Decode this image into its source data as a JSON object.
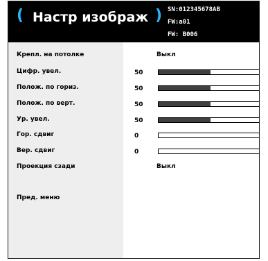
{
  "header": {
    "left_paren": "(",
    "title": "Настр изображ",
    "right_paren": ")",
    "serial": "SN:012345678AB",
    "fw1": "FW:a01",
    "fw2": "FW: B006"
  },
  "menu": {
    "items": [
      {
        "label": "Крепл. на потолке",
        "text_value": "Выкл"
      },
      {
        "label": "Цифр. увел.",
        "value": "50",
        "level": 0.5
      },
      {
        "label": "Полож. по гориз.",
        "value": "50",
        "level": 0.5
      },
      {
        "label": "Полож. по верт.",
        "value": "50",
        "level": 0.5
      },
      {
        "label": "Ур. увел.",
        "value": "50",
        "level": 0.5
      },
      {
        "label": "Гор. сдвиг",
        "value": "0",
        "level": 0
      },
      {
        "label": "Вер. сдвиг",
        "value": "0",
        "level": 0
      },
      {
        "label": "Проекция сзади",
        "text_value": "Выкл"
      }
    ],
    "previous_menu": "Пред. меню"
  },
  "colors": {
    "header_bg": "#000000",
    "accent": "#29b6f6",
    "label_panel": "#eeeeee",
    "bar_fill": "#404040"
  }
}
